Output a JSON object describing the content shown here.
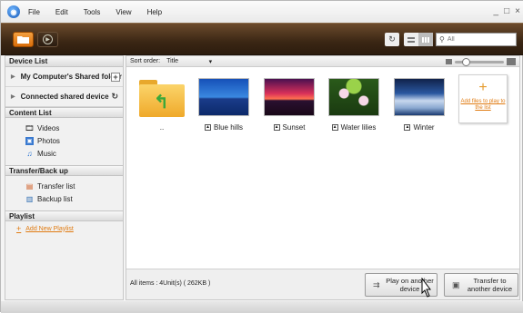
{
  "menu": {
    "items": [
      "File",
      "Edit",
      "Tools",
      "View",
      "Help"
    ]
  },
  "window_controls": {
    "minimize": "_",
    "maximize": "□",
    "close": "×"
  },
  "search": {
    "placeholder": "All"
  },
  "sidebar": {
    "device_list_header": "Device List",
    "devices": [
      {
        "label": "My Computer's Shared folder"
      },
      {
        "label": "Connected shared device"
      }
    ],
    "content_list_header": "Content List",
    "content_items": [
      {
        "label": "Videos",
        "icon": "video-icon"
      },
      {
        "label": "Photos",
        "icon": "photo-icon"
      },
      {
        "label": "Music",
        "icon": "music-icon"
      }
    ],
    "transfer_header": "Transfer/Back up",
    "transfer_items": [
      {
        "label": "Transfer list",
        "icon": "transfer-icon"
      },
      {
        "label": "Backup list",
        "icon": "backup-icon"
      }
    ],
    "playlist_header": "Playlist",
    "add_playlist": "Add New Playlist"
  },
  "sort": {
    "label": "Sort order:",
    "value": "Title"
  },
  "tiles": [
    {
      "label": ".."
    },
    {
      "label": "Blue hills"
    },
    {
      "label": "Sunset"
    },
    {
      "label": "Water lilies"
    },
    {
      "label": "Winter"
    }
  ],
  "add_files": {
    "text": "Add files to play to the list"
  },
  "bottom": {
    "items_count": "All items : 4Unit(s) ( 262KB )",
    "play_button": "Play on another device",
    "transfer_button": "Transfer to another device"
  }
}
